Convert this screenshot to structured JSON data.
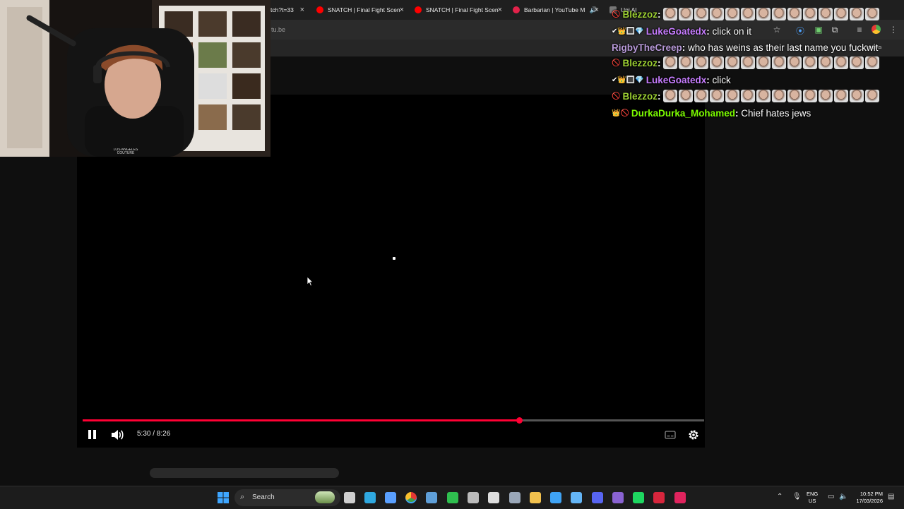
{
  "browser": {
    "tabs": [
      {
        "title": "tch?t=33",
        "favicon_color": "#ff0000"
      },
      {
        "title": "SNATCH | Final Fight Scen",
        "favicon_color": "#ff0000"
      },
      {
        "title": "SNATCH | Final Fight Scen",
        "favicon_color": "#ff0000"
      },
      {
        "title": "Barbarian | YouTube M",
        "favicon_color": "#e3224a"
      },
      {
        "title": "Uni Al",
        "favicon_color": "#777777"
      }
    ],
    "close_glyph": "×",
    "address_text": "tu.be",
    "bookmarks_label": "marks",
    "toolbar_icons": [
      "star-icon",
      "extension-icon",
      "puzzle-icon",
      "media-icon",
      "profile-icon",
      "menu-icon"
    ]
  },
  "player": {
    "time_display": "5:30 / 8:26",
    "progress_fraction": 0.702,
    "accent_color": "#ff0033",
    "icons": [
      "pause-icon",
      "volume-icon",
      "captions-icon",
      "settings-gear-icon"
    ]
  },
  "chat": {
    "messages": [
      {
        "user": "Blezzoz",
        "user_color": "#9acd32",
        "text": "",
        "emote_count": 14,
        "badges": "🚫"
      },
      {
        "user": "LukeGoatedx",
        "user_color": "#c77dff",
        "text": "click on it",
        "emote_count": 0,
        "badges": "✔👑🔳💎"
      },
      {
        "user": "RigbyTheCreep",
        "user_color": "#b89ad9",
        "text": "who has weins as their last name you fuckwit",
        "emote_count": 0,
        "badges": ""
      },
      {
        "user": "Blezzoz",
        "user_color": "#9acd32",
        "text": "",
        "emote_count": 14,
        "badges": "🚫"
      },
      {
        "user": "LukeGoatedx",
        "user_color": "#c77dff",
        "text": "click",
        "emote_count": 0,
        "badges": "✔👑🔳💎"
      },
      {
        "user": "Blezzoz",
        "user_color": "#9acd32",
        "text": "",
        "emote_count": 14,
        "badges": "🚫"
      },
      {
        "user": "DurkaDurka_Mohamed",
        "user_color": "#7cfc00",
        "text": "Chief hates jews",
        "emote_count": 0,
        "badges": "👑🚫"
      }
    ]
  },
  "webcam": {
    "shirt_text": "LOS ANGELES COUTURE"
  },
  "taskbar": {
    "search_label": "Search",
    "lang_line1": "ENG",
    "lang_line2": "US",
    "time": "10:52 PM",
    "date": "17/03/2026",
    "app_icons": [
      {
        "name": "task-view-icon",
        "color": "#cfcfcf"
      },
      {
        "name": "edge-icon",
        "color": "#2fa8e0"
      },
      {
        "name": "app-blue-icon",
        "color": "#5aa0ff"
      },
      {
        "name": "chrome-icon",
        "color": "#e9b94a"
      },
      {
        "name": "steam-icon",
        "color": "#5f9fd8"
      },
      {
        "name": "xbox-icon",
        "color": "#2fbf4f"
      },
      {
        "name": "app-ring-icon",
        "color": "#bbbbbb"
      },
      {
        "name": "epic-icon",
        "color": "#dddddd"
      },
      {
        "name": "settings-icon",
        "color": "#9aa7b8"
      },
      {
        "name": "file-explorer-icon",
        "color": "#f2c14e"
      },
      {
        "name": "store-icon",
        "color": "#3fa3f5"
      },
      {
        "name": "folder-icon",
        "color": "#64b5f6"
      },
      {
        "name": "discord-icon",
        "color": "#5865f2"
      },
      {
        "name": "app-purple-icon",
        "color": "#8a63d2"
      },
      {
        "name": "spotify-icon",
        "color": "#1ed760"
      },
      {
        "name": "gta-icon",
        "color": "#d7263d"
      },
      {
        "name": "app-pink-icon",
        "color": "#e0245e"
      }
    ]
  }
}
